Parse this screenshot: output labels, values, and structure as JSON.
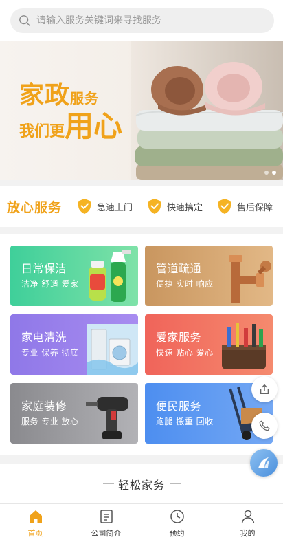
{
  "search": {
    "placeholder": "请输入服务关键词来寻找服务",
    "icon": "search-icon"
  },
  "banner": {
    "line1_big": "家政",
    "line1_small": "服务",
    "line2_small": "我们更",
    "line2_big": "用心",
    "slides": 2,
    "active_slide": 2,
    "accent": "#f0a21a"
  },
  "assurance": {
    "title": "放心服务",
    "items": [
      {
        "label": "急速上门",
        "icon": "shield-check-icon"
      },
      {
        "label": "快速搞定",
        "icon": "shield-check-icon"
      },
      {
        "label": "售后保障",
        "icon": "shield-check-icon"
      }
    ]
  },
  "services": [
    {
      "title": "日常保洁",
      "sub": "洁净 舒适 爱家",
      "color_from": "#3fcf9a",
      "color_to": "#7fe2a8",
      "icon": "cleaning-spray-icon"
    },
    {
      "title": "管道疏通",
      "sub": "便捷 实时 响应",
      "color_from": "#c9965f",
      "color_to": "#e2b886",
      "icon": "pipe-fitting-icon"
    },
    {
      "title": "家电清洗",
      "sub": "专业 保养 彻底",
      "color_from": "#8f78e8",
      "color_to": "#a88cf0",
      "icon": "appliances-icon"
    },
    {
      "title": "爱家服务",
      "sub": "快速 贴心 爱心",
      "color_from": "#f0645a",
      "color_to": "#f58a6e",
      "icon": "tool-bag-icon"
    },
    {
      "title": "家庭装修",
      "sub": "服务 专业 放心",
      "color_from": "#8a8a8e",
      "color_to": "#b2b2b6",
      "icon": "power-drill-icon"
    },
    {
      "title": "便民服务",
      "sub": "跑腿 搬重 回收",
      "color_from": "#4d8ef0",
      "color_to": "#74a8f4",
      "icon": "hand-truck-icon"
    }
  ],
  "section": {
    "title": "轻松家务"
  },
  "fabs": [
    {
      "icon": "share-icon"
    },
    {
      "icon": "phone-icon"
    },
    {
      "icon": "brand-logo-icon"
    }
  ],
  "tabs": [
    {
      "label": "首页",
      "icon": "home-icon",
      "active": true
    },
    {
      "label": "公司简介",
      "icon": "document-icon",
      "active": false
    },
    {
      "label": "预约",
      "icon": "clock-icon",
      "active": false
    },
    {
      "label": "我的",
      "icon": "user-icon",
      "active": false
    }
  ],
  "colors": {
    "accent": "#f0a21a",
    "text": "#333333",
    "inactive_icon": "#555555"
  }
}
